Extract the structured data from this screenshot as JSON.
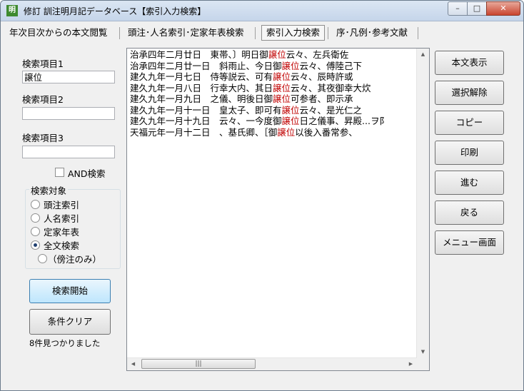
{
  "window": {
    "title": "修訂 訓注明月記データベース【索引入力検索】",
    "app_icon": "明",
    "controls": {
      "minimize": "–",
      "maximize": "□",
      "close": "✕"
    }
  },
  "tabs": [
    {
      "label": "年次目次からの本文閲覧",
      "active": false
    },
    {
      "label": "頭注･人名索引･定家年表検索",
      "active": false
    },
    {
      "label": "索引入力検索",
      "active": true
    },
    {
      "label": "序･凡例･参考文献",
      "active": false
    }
  ],
  "search_fields": [
    {
      "label": "検索項目1",
      "value": "譲位"
    },
    {
      "label": "検索項目2",
      "value": ""
    },
    {
      "label": "検索項目3",
      "value": ""
    }
  ],
  "and_search": {
    "label": "AND検索",
    "checked": false
  },
  "search_target": {
    "title": "検索対象",
    "options": [
      {
        "label": "頭注索引",
        "selected": false
      },
      {
        "label": "人名索引",
        "selected": false
      },
      {
        "label": "定家年表",
        "selected": false
      },
      {
        "label": "全文検索",
        "selected": true
      }
    ],
    "sub_option": {
      "label": "（傍注のみ）",
      "selected": false
    }
  },
  "buttons": {
    "search_start": "検索開始",
    "clear": "条件クリア"
  },
  "status": "8件見つかりました",
  "results": [
    {
      "pre": "治承四年二月廿日　東帯、〕明日御",
      "hit": "譲位",
      "post": "云々、左兵衛佐"
    },
    {
      "pre": "治承四年二月廿一日　斜雨止、今日御",
      "hit": "譲位",
      "post": "云々、傅陸己下"
    },
    {
      "pre": "建久九年一月七日　侍等説云、可有",
      "hit": "譲位",
      "post": "云々、辰時許或"
    },
    {
      "pre": "建久九年一月八日　行幸大内、其日",
      "hit": "譲位",
      "post": "云々、其夜御幸大炊"
    },
    {
      "pre": "建久九年一月九日　之儀、明後日御",
      "hit": "譲位",
      "post": "可参者、即示承"
    },
    {
      "pre": "建久九年一月十一日　皇太子、即可有",
      "hit": "譲位",
      "post": "云々、是光仁之"
    },
    {
      "pre": "建久九年一月十九日　云々、一今度御",
      "hit": "譲位",
      "post": "日之儀事、昇殿...ヲ阝"
    },
    {
      "pre": "天福元年一月十二日　、基氏卿、［御",
      "hit": "譲位",
      "post": "以後入番常参、"
    }
  ],
  "right_buttons": [
    "本文表示",
    "選択解除",
    "コピー",
    "印刷",
    "進む",
    "戻る",
    "メニュー画面"
  ],
  "colors": {
    "highlight": "#c00000",
    "accent": "#3c7fb1"
  }
}
